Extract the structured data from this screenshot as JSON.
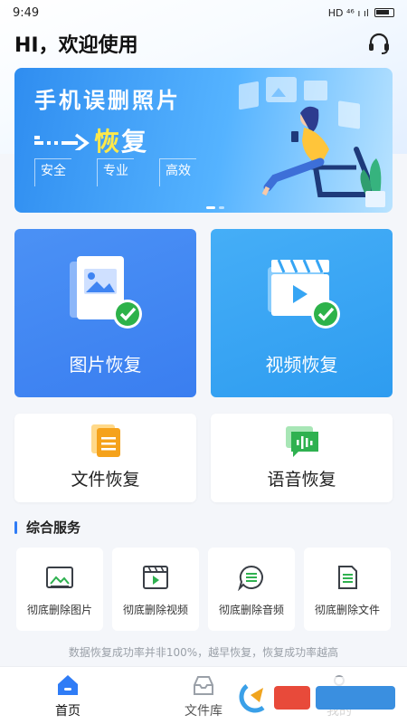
{
  "status_bar": {
    "time": "9:49",
    "indicators": "HD ⁴⁶ ı ıl",
    "battery_icon": "battery-icon"
  },
  "header": {
    "greeting": "HI，欢迎使用",
    "support_icon": "headset-icon"
  },
  "banner": {
    "title": "手机误删照片",
    "recover_highlight": "恢",
    "recover_rest": "复",
    "tags": [
      "安全",
      "专业",
      "高效"
    ],
    "slide_index": 1,
    "slide_count": 2
  },
  "main_cards": [
    {
      "label": "图片恢复",
      "icon": "image-check-icon"
    },
    {
      "label": "视频恢复",
      "icon": "video-check-icon"
    }
  ],
  "secondary_cards": [
    {
      "label": "文件恢复",
      "icon": "document-icon"
    },
    {
      "label": "语音恢复",
      "icon": "voice-message-icon"
    }
  ],
  "services_section": {
    "title": "综合服务",
    "items": [
      {
        "label": "彻底删除图片",
        "icon": "image-delete-icon"
      },
      {
        "label": "彻底删除视频",
        "icon": "video-delete-icon"
      },
      {
        "label": "彻底删除音频",
        "icon": "audio-delete-icon"
      },
      {
        "label": "彻底删除文件",
        "icon": "file-delete-icon"
      }
    ]
  },
  "notice": "数据恢复成功率并非100%，越早恢复，恢复成功率越高",
  "bottom_nav": [
    {
      "label": "首页",
      "icon": "home-icon",
      "active": true
    },
    {
      "label": "文件库",
      "icon": "inbox-icon",
      "active": false
    },
    {
      "label": "我的",
      "icon": "profile-icon",
      "active": false
    }
  ],
  "colors": {
    "accent": "#2f7cf6",
    "photo_card": "#3f84f2",
    "video_card": "#36a5f4",
    "highlight": "#ffe94a"
  }
}
